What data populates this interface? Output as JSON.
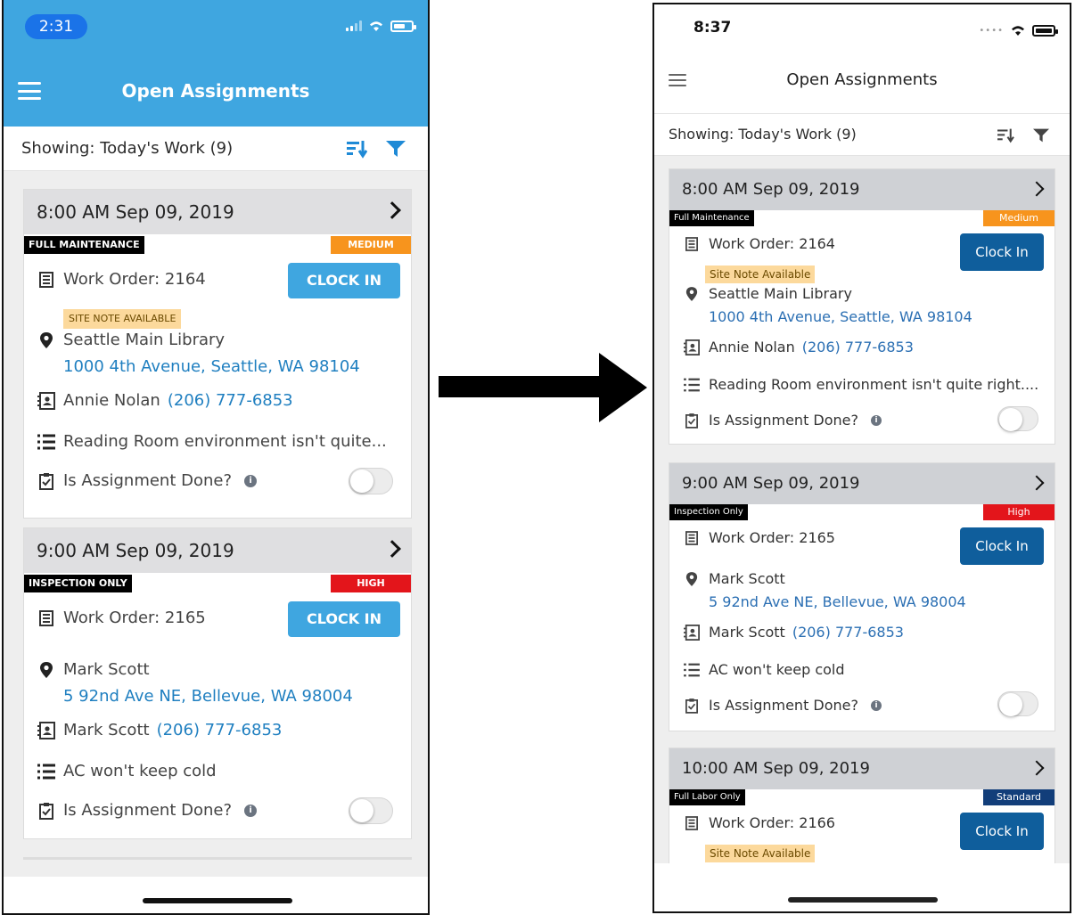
{
  "left": {
    "status_time": "2:31",
    "header_title": "Open Assignments",
    "showing_text": "Showing: Today's Work (9)",
    "assignments": [
      {
        "datetime": "8:00 AM Sep 09, 2019",
        "type_tag": "FULL MAINTENANCE",
        "priority": "MEDIUM",
        "work_order": "Work Order: 2164",
        "clock_in": "CLOCK IN",
        "site_note": "SITE NOTE AVAILABLE",
        "location_name": "Seattle Main Library",
        "address": "1000 4th Avenue, Seattle, WA 98104",
        "contact_name": "Annie Nolan",
        "phone": "(206) 777-6853",
        "description": "Reading Room environment isn't quite...",
        "done_label": "Is Assignment Done?"
      },
      {
        "datetime": "9:00 AM Sep 09, 2019",
        "type_tag": "INSPECTION ONLY",
        "priority": "HIGH",
        "work_order": "Work Order: 2165",
        "clock_in": "CLOCK IN",
        "location_name": "Mark Scott",
        "address": "5 92nd Ave NE, Bellevue, WA 98004",
        "contact_name": "Mark Scott",
        "phone": "(206) 777-6853",
        "description": "AC won't keep cold",
        "done_label": "Is Assignment Done?"
      }
    ]
  },
  "right": {
    "status_time": "8:37",
    "header_title": "Open Assignments",
    "showing_text": "Showing: Today's Work (9)",
    "assignments": [
      {
        "datetime": "8:00 AM Sep 09, 2019",
        "type_tag": "Full Maintenance",
        "priority": "Medium",
        "work_order": "Work Order: 2164",
        "clock_in": "Clock In",
        "site_note": "Site Note Available",
        "location_name": "Seattle Main Library",
        "address": "1000 4th Avenue, Seattle, WA 98104",
        "contact_name": "Annie Nolan",
        "phone": "(206) 777-6853",
        "description": "Reading Room environment isn't quite right....",
        "done_label": "Is Assignment Done?"
      },
      {
        "datetime": "9:00 AM Sep 09, 2019",
        "type_tag": "Inspection Only",
        "priority": "High",
        "work_order": "Work Order: 2165",
        "clock_in": "Clock In",
        "location_name": "Mark Scott",
        "address": "5 92nd Ave NE, Bellevue, WA 98004",
        "contact_name": "Mark Scott",
        "phone": "(206) 777-6853",
        "description": "AC won't keep cold",
        "done_label": "Is Assignment Done?"
      },
      {
        "datetime": "10:00 AM Sep 09, 2019",
        "type_tag": "Full Labor Only",
        "priority": "Standard",
        "work_order": "Work Order: 2166",
        "clock_in": "Clock In",
        "site_note": "Site Note Available"
      }
    ]
  },
  "colors": {
    "left_header_blue": "#3fa6e0",
    "left_button_blue": "#3fa6e0",
    "right_button_blue": "#0f5e9c",
    "priority_medium": "#f7941d",
    "priority_high": "#e3151b",
    "priority_standard": "#123e7a",
    "link_blue": "#1f7fc0",
    "site_note_bg": "#fcd99c"
  },
  "icons": [
    "hamburger-icon",
    "sort-icon",
    "filter-icon",
    "chevron-right-icon",
    "document-icon",
    "map-pin-icon",
    "contact-card-icon",
    "list-icon",
    "clipboard-check-icon",
    "info-icon",
    "wifi-icon",
    "battery-icon",
    "cellular-icon",
    "arrow-right-icon"
  ]
}
